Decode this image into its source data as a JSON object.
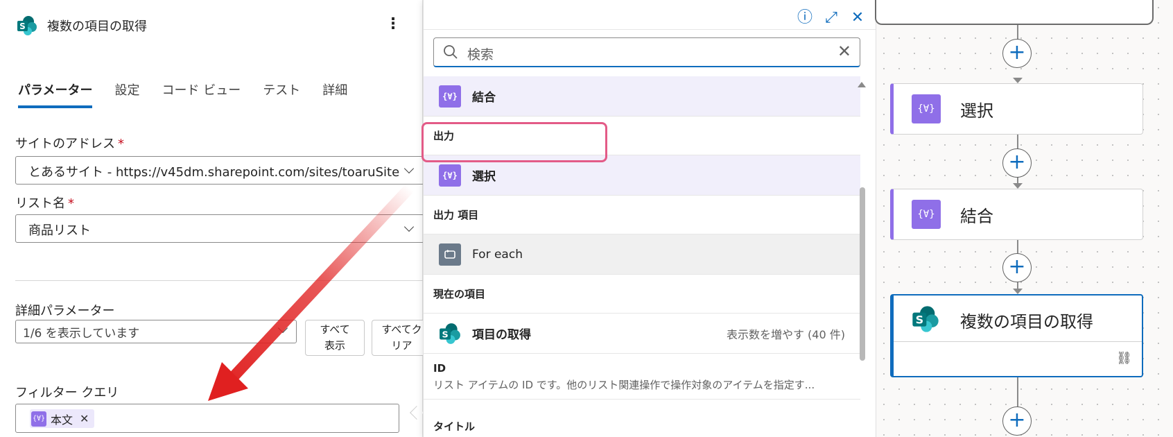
{
  "panel": {
    "title": "複数の項目の取得",
    "more_icon": "⋮",
    "tabs": [
      "パラメーター",
      "設定",
      "コード ビュー",
      "テスト",
      "詳細"
    ],
    "site_label": "サイトのアドレス",
    "site_value": "とあるサイト - https://v45dm.sharepoint.com/sites/toaruSite",
    "list_label": "リスト名",
    "list_value": "商品リスト",
    "required_mark": "*",
    "adv_label": "詳細パラメーター",
    "adv_value": "1/6 を表示しています",
    "show_all_l1": "すべて",
    "show_all_l2": "表示",
    "clear_all_l1": "すべてク",
    "clear_all_l2": "リア",
    "filter_label": "フィルター クエリ",
    "chip_label": "本文",
    "chip_close": "✕"
  },
  "popup": {
    "search_placeholder": "検索",
    "info_icon": "ⓘ",
    "expand_icon": "⤢",
    "close_icon": "✕",
    "clear_icon": "✕",
    "row_join": "結合",
    "sect_output": "出力",
    "row_select": "選択",
    "sect_output_item": "出力 項目",
    "row_foreach": "For each",
    "sect_current": "現在の項目",
    "row_getitems": "項目の取得",
    "more_info": "表示数を増やす (40 件)",
    "id_name": "ID",
    "id_desc": "リスト アイテムの ID です。他のリスト関連操作で操作対象のアイテムを指定す...",
    "title_name": "タイトル"
  },
  "flow": {
    "card_select": "選択",
    "card_join": "結合",
    "card_getitems": "複数の項目の取得",
    "plus": "+",
    "link_icon": "⛓"
  },
  "colors": {
    "accent": "#0f6cbd",
    "variable_icon": "#8f6fe8",
    "highlight": "#e35b87",
    "arrow": "#e02020"
  },
  "icons": {
    "variable": "{∀}",
    "sharepoint": "S"
  }
}
